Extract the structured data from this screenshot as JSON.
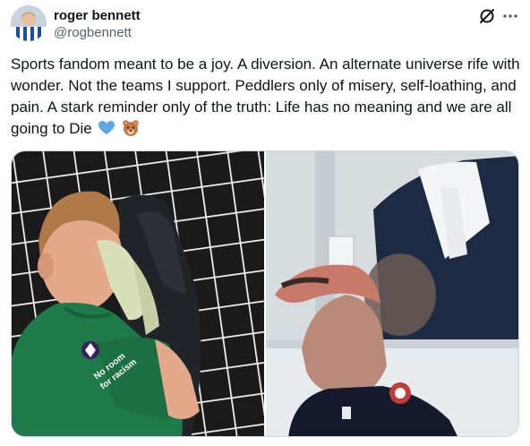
{
  "author": {
    "display_name": "roger bennett",
    "handle": "@rogbennett",
    "avatar_icon": "profile-photo-avatar"
  },
  "header_icons": {
    "grok": "grok-icon",
    "more": "more-options-icon"
  },
  "tweet": {
    "text": "Sports fandom meant to be a joy. A diversion. An alternate universe rife with wonder. Not the teams I support. Peddlers only of misery, self-loathing, and pain. A stark reminder only of the truth: Life has no meaning and we are all going to Die",
    "emojis": [
      "blue-heart",
      "bear-face"
    ]
  },
  "media": {
    "left": {
      "description_icon": "goalkeeper-photo",
      "shirt_text": "No room for racism",
      "colors": {
        "shirt": "#1f7a4a",
        "net": "#f2f2f2",
        "background": "#1a1a1a"
      }
    },
    "right": {
      "description_icon": "fan-in-stands-photo",
      "colors": {
        "cap": "#c87a6a",
        "wall": "#dfe3e6",
        "jacket": "#1d2a44"
      }
    }
  },
  "colors": {
    "text_primary": "#0f1419",
    "text_secondary": "#536471",
    "border": "#cfd9de",
    "heart": "#5aa9e6"
  }
}
